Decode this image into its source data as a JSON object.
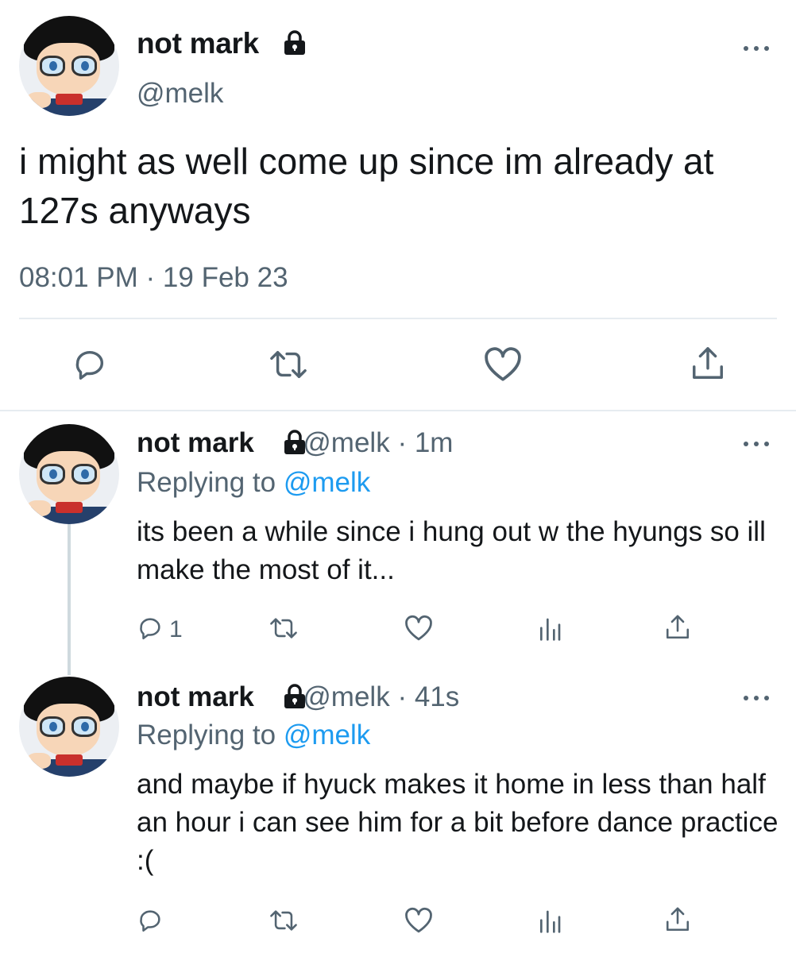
{
  "main_tweet": {
    "name": "not mark",
    "handle": "@melk",
    "text": "i might as well come up since im already at 127s anyways",
    "timestamp": "08:01 PM · 19 Feb 23"
  },
  "replies": [
    {
      "name": "not mark",
      "handle": "@melk",
      "time": "· 1m",
      "replying_label": "Replying to",
      "replying_to": "@melk",
      "text": "its been a while since i hung out w the hyungs so ill make the most of it...",
      "reply_count": "1"
    },
    {
      "name": "not mark",
      "handle": "@melk",
      "time": "· 41s",
      "replying_label": "Replying to",
      "replying_to": "@melk",
      "text": "and maybe if hyuck makes it home in less than half an hour i can see him for a bit before dance practice :(",
      "reply_count": ""
    }
  ],
  "colors": {
    "text": "#14171a",
    "secondary": "#536471",
    "link": "#1d9bf0",
    "divider": "#e6ecf0"
  },
  "icons": [
    "lock-icon",
    "more-icon",
    "reply-icon",
    "retweet-icon",
    "like-icon",
    "share-icon",
    "analytics-icon"
  ]
}
